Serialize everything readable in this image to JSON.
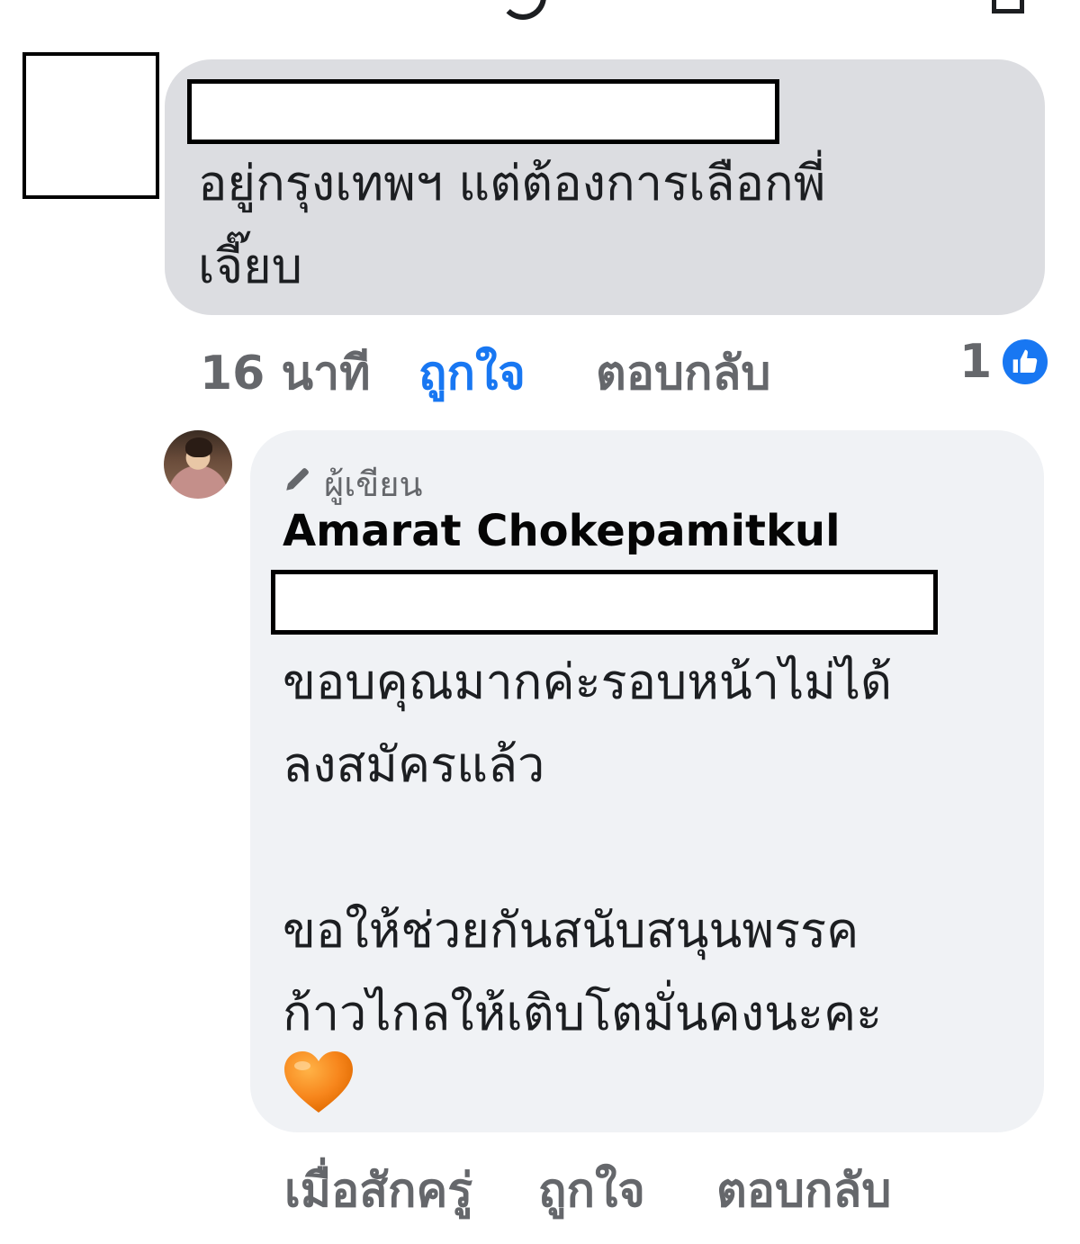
{
  "comment_1": {
    "text": "อยู่กรุงเทพฯ แต่ต้องการเลือกพี่\nเจี๊ยบ",
    "time": "16 นาที",
    "like_label": "ถูกใจ",
    "reply_label": "ตอบกลับ",
    "reaction_count": "1",
    "reaction_icon": "thumbs-up-icon",
    "like_color": "#1877f2"
  },
  "comment_2": {
    "badge_label": "ผู้เขียน",
    "badge_icon": "pencil-icon",
    "author": "Amarat Chokepamitkul",
    "text": "ขอบคุณมากค่ะรอบหน้าไม่ได้\nลงสมัครแล้ว\n\nขอให้ช่วยกันสนับสนุนพรรค\nก้าวไกลให้เติบโตมั่นคงนะคะ",
    "emoji_icon": "orange-heart-icon",
    "time": "เมื่อสักครู่",
    "like_label": "ถูกใจ",
    "reply_label": "ตอบกลับ"
  }
}
